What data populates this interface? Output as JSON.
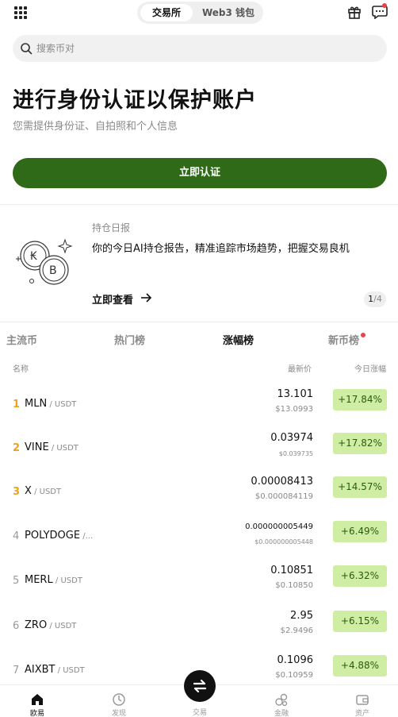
{
  "topbar": {
    "segment_active": "交易所",
    "segment_inactive": "Web3 钱包"
  },
  "search": {
    "placeholder": "搜索币对"
  },
  "verify": {
    "title": "进行身份认证以保护账户",
    "subtitle": "您需提供身份证、自拍照和个人信息",
    "button": "立即认证"
  },
  "card": {
    "label": "持仓日报",
    "text": "你的今日AI持仓报告，精准追踪市场趋势，把握交易良机",
    "link": "立即查看",
    "page_current": "1",
    "page_total": "/4"
  },
  "tabs": [
    "主流币",
    "热门榜",
    "涨幅榜",
    "新币榜"
  ],
  "columns": {
    "name": "名称",
    "price": "最新价",
    "change": "今日涨幅"
  },
  "rows": [
    {
      "rank": "1",
      "symbol": "MLN",
      "quote": " / USDT",
      "price": "13.101",
      "usd": "$13.0993",
      "change": "+17.84%"
    },
    {
      "rank": "2",
      "symbol": "VINE",
      "quote": " / USDT",
      "price": "0.03974",
      "usd": "$0.039735",
      "change": "+17.82%"
    },
    {
      "rank": "3",
      "symbol": "X",
      "quote": " / USDT",
      "price": "0.00008413",
      "usd": "$0.000084119",
      "change": "+14.57%"
    },
    {
      "rank": "4",
      "symbol": "POLYDOGE",
      "quote": " /...",
      "price": "0.000000005449",
      "usd": "$0.000000005448",
      "change": "+6.49%"
    },
    {
      "rank": "5",
      "symbol": "MERL",
      "quote": " / USDT",
      "price": "0.10851",
      "usd": "$0.10850",
      "change": "+6.32%"
    },
    {
      "rank": "6",
      "symbol": "ZRO",
      "quote": " / USDT",
      "price": "2.95",
      "usd": "$2.9496",
      "change": "+6.15%"
    },
    {
      "rank": "7",
      "symbol": "AIXBT",
      "quote": " / USDT",
      "price": "0.1096",
      "usd": "$0.10959",
      "change": "+4.88%"
    }
  ],
  "nav": {
    "home": "欧易",
    "discover": "发现",
    "trade": "交易",
    "finance": "金融",
    "assets": "资产"
  },
  "colors": {
    "accent": "#2e6a17",
    "gain_bg": "#cfeea3",
    "gain_text": "#2b5a12",
    "rank_top": "#f0a21a",
    "dot": "#e8424b"
  },
  "icons": [
    "apps-grid-icon",
    "gift-icon",
    "message-icon",
    "search-icon",
    "coins-illustration",
    "arrow-right-icon",
    "home-icon",
    "discover-icon",
    "swap-icon",
    "finance-icon",
    "wallet-icon"
  ]
}
